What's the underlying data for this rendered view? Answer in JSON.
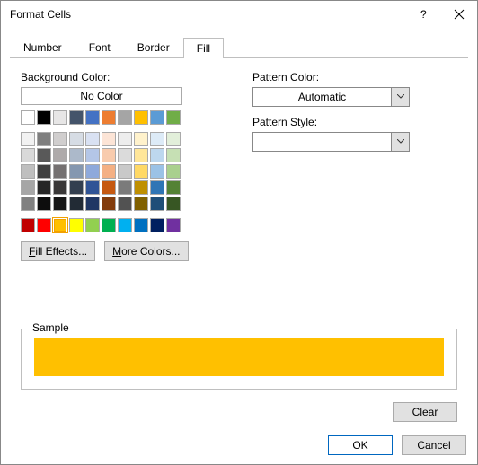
{
  "title": "Format Cells",
  "tabs": [
    "Number",
    "Font",
    "Border",
    "Fill"
  ],
  "active_tab": "Fill",
  "labels": {
    "background_color": "Background Color:",
    "no_color": "No Color",
    "pattern_color": "Pattern Color:",
    "pattern_style": "Pattern Style:",
    "sample": "Sample"
  },
  "buttons": {
    "fill_effects": "Fill Effects...",
    "more_colors": "More Colors...",
    "clear": "Clear",
    "ok": "OK",
    "cancel": "Cancel"
  },
  "pattern_color_value": "Automatic",
  "pattern_style_value": "",
  "sample_color": "#ffc000",
  "palette_top": [
    [
      "#ffffff",
      "#000000",
      "#e7e6e6",
      "#44546a",
      "#4472c4",
      "#ed7d31",
      "#a5a5a5",
      "#ffc000",
      "#5b9bd5",
      "#70ad47"
    ]
  ],
  "palette_theme": [
    [
      "#f2f2f2",
      "#7f7f7f",
      "#d0cece",
      "#d6dce4",
      "#d9e1f2",
      "#fce4d6",
      "#ededed",
      "#fff2cc",
      "#ddebf7",
      "#e2efda"
    ],
    [
      "#d9d9d9",
      "#595959",
      "#aeaaaa",
      "#acb9ca",
      "#b4c6e7",
      "#f8cbad",
      "#dbdbdb",
      "#ffe699",
      "#bdd7ee",
      "#c6e0b4"
    ],
    [
      "#bfbfbf",
      "#404040",
      "#757171",
      "#8497b0",
      "#8ea9db",
      "#f4b084",
      "#c9c9c9",
      "#ffd966",
      "#9bc2e6",
      "#a9d08e"
    ],
    [
      "#a6a6a6",
      "#262626",
      "#3a3838",
      "#333f4f",
      "#305496",
      "#c65911",
      "#7b7b7b",
      "#bf8f00",
      "#2f75b5",
      "#548235"
    ],
    [
      "#808080",
      "#0d0d0d",
      "#161616",
      "#222b35",
      "#203764",
      "#833c0c",
      "#525252",
      "#806000",
      "#1f4e78",
      "#375623"
    ]
  ],
  "palette_standard": [
    [
      "#c00000",
      "#ff0000",
      "#ffc000",
      "#ffff00",
      "#92d050",
      "#00b050",
      "#00b0f0",
      "#0070c0",
      "#002060",
      "#7030a0"
    ]
  ],
  "selected_swatch": "palette_standard.0.2"
}
